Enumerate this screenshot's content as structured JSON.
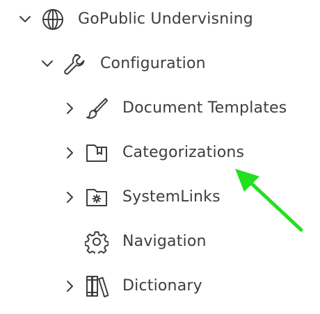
{
  "tree": {
    "root": {
      "label": "GoPublic Undervisning",
      "icon": "globe-icon",
      "expanded": true
    },
    "config": {
      "label": "Configuration",
      "icon": "wrench-icon",
      "expanded": true
    },
    "items": [
      {
        "label": "Document Templates",
        "icon": "paintbrush-icon",
        "has_children": true
      },
      {
        "label": "Categorizations",
        "icon": "bookmark-folder-icon",
        "has_children": true
      },
      {
        "label": "SystemLinks",
        "icon": "gear-folder-icon",
        "has_children": true
      },
      {
        "label": "Navigation",
        "icon": "gear-icon",
        "has_children": false
      },
      {
        "label": "Dictionary",
        "icon": "books-icon",
        "has_children": true
      }
    ]
  },
  "annotation": {
    "arrow_color": "#22e01e"
  }
}
